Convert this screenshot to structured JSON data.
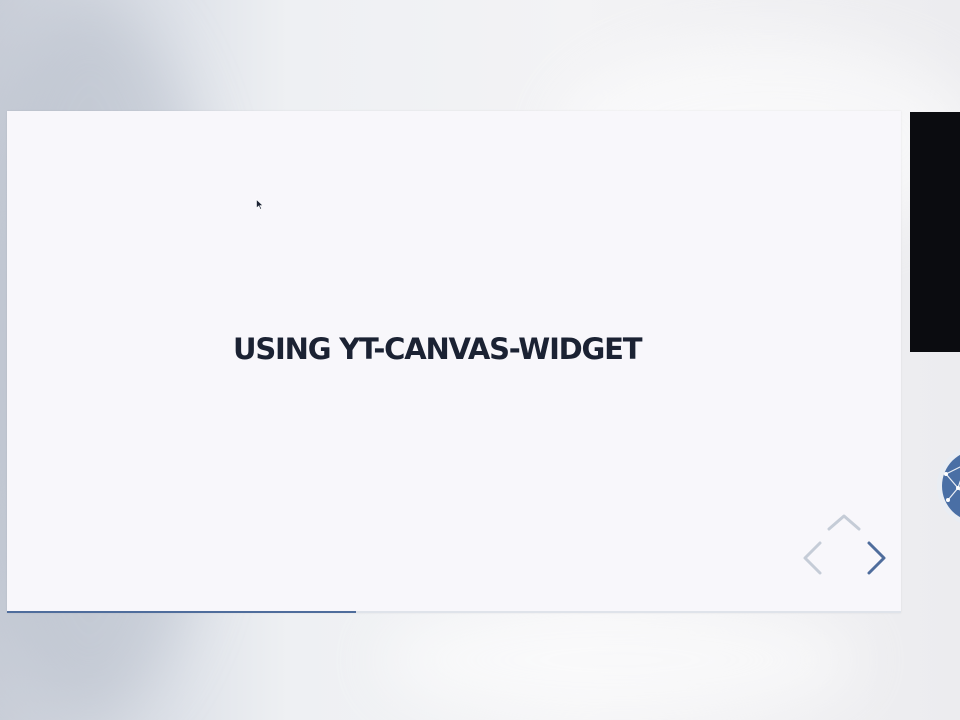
{
  "slide": {
    "title": "USING YT-CANVAS-WIDGET",
    "progress": 0.39
  },
  "navigation": {
    "controls": [
      "up-arrow-icon",
      "left-arrow-icon",
      "right-arrow-icon"
    ]
  },
  "colors": {
    "slide_background": "#f8f7fb",
    "title_text": "#1b2233",
    "progress_fill": "#4f6d9c",
    "nav_active": "#4f6d9c",
    "nav_disabled": "#c5ccd7",
    "side_panel": "#0b0c10",
    "globe": "#4a6fa5"
  }
}
